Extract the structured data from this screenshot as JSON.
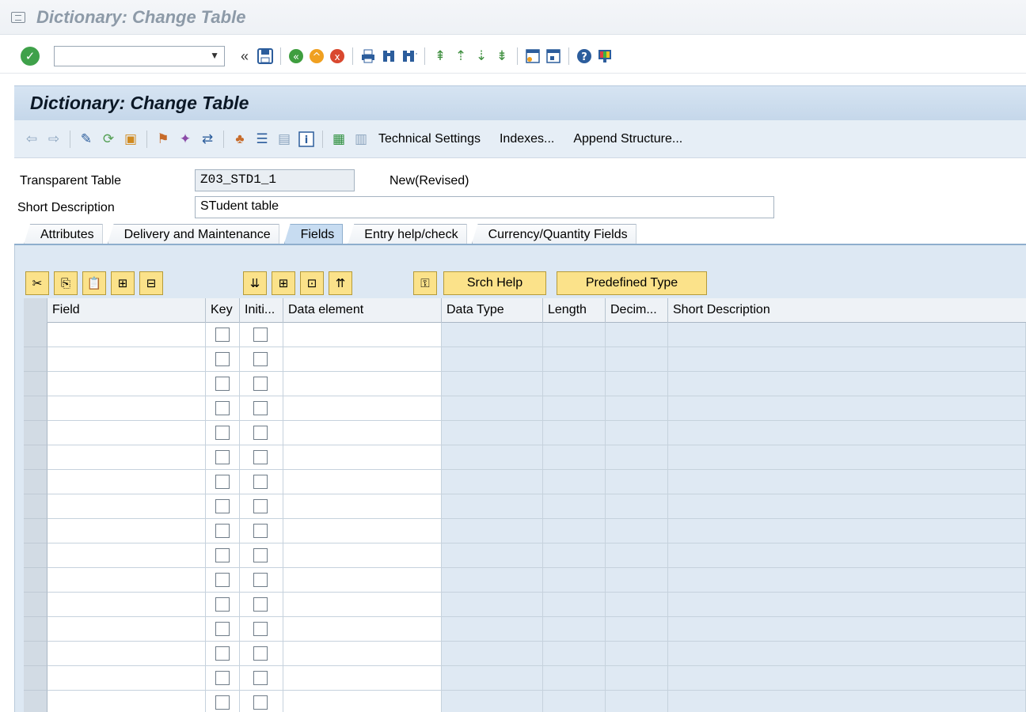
{
  "window": {
    "title": "Dictionary: Change Table"
  },
  "standard_toolbar": {
    "command_field": {
      "value": "",
      "placeholder": ""
    },
    "icons": [
      "enter-check-icon",
      "double-chevron-left-icon",
      "save-icon",
      "back-icon",
      "exit-icon",
      "cancel-icon",
      "print-icon",
      "find-icon",
      "find-next-icon",
      "first-page-icon",
      "previous-page-icon",
      "next-page-icon",
      "last-page-icon",
      "create-session-icon",
      "shortcut-icon",
      "help-icon",
      "layout-menu-icon"
    ]
  },
  "panel": {
    "title": "Dictionary: Change Table",
    "toolbar": {
      "technical_settings": "Technical Settings",
      "indexes": "Indexes...",
      "append_structure": "Append Structure..."
    }
  },
  "form": {
    "transparent_table_label": "Transparent Table",
    "transparent_table_value": "Z03_STD1_1",
    "status": "New(Revised)",
    "short_description_label": "Short Description",
    "short_description_value": "STudent table"
  },
  "tabs": [
    {
      "label": "Attributes",
      "active": false
    },
    {
      "label": "Delivery and Maintenance",
      "active": false
    },
    {
      "label": "Fields",
      "active": true
    },
    {
      "label": "Entry help/check",
      "active": false
    },
    {
      "label": "Currency/Quantity Fields",
      "active": false
    }
  ],
  "fields_toolbar": {
    "srch_help": "Srch Help",
    "predefined_type": "Predefined Type"
  },
  "grid": {
    "columns": [
      "Field",
      "Key",
      "Initi...",
      "Data element",
      "Data Type",
      "Length",
      "Decim...",
      "Short Description"
    ],
    "row_count": 16
  }
}
